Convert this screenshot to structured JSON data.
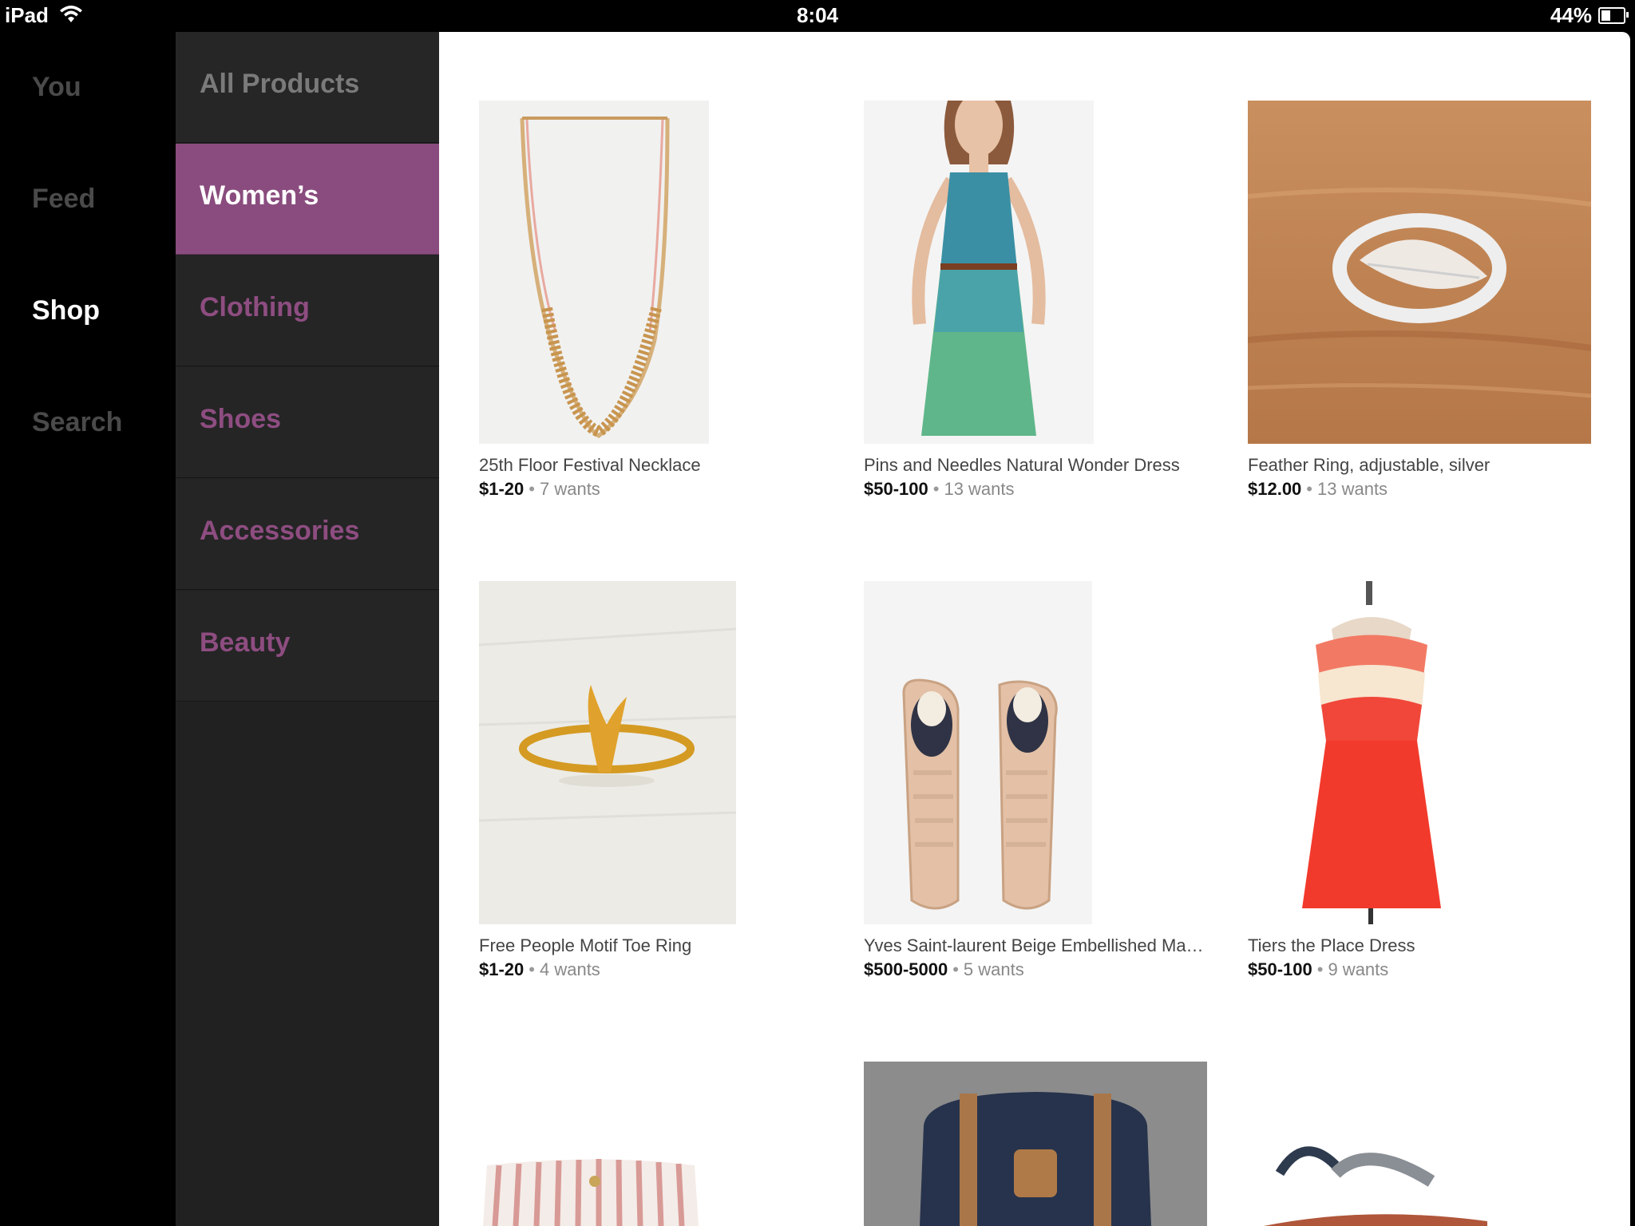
{
  "status_bar": {
    "device": "iPad",
    "time": "8:04",
    "battery": "44%",
    "battery_level": 0.44
  },
  "main_nav": {
    "items": [
      {
        "label": "You",
        "active": false
      },
      {
        "label": "Feed",
        "active": false
      },
      {
        "label": "Shop",
        "active": true
      },
      {
        "label": "Search",
        "active": false
      }
    ]
  },
  "category_nav": {
    "items": [
      {
        "label": "All Products",
        "state": "parent"
      },
      {
        "label": "Women’s",
        "state": "active"
      },
      {
        "label": "Clothing",
        "state": "normal"
      },
      {
        "label": "Shoes",
        "state": "normal"
      },
      {
        "label": "Accessories",
        "state": "normal"
      },
      {
        "label": "Beauty",
        "state": "normal"
      }
    ]
  },
  "products": [
    {
      "title": "25th Floor Festival Necklace",
      "price": "$1-20",
      "wants": "7 wants",
      "image": "necklace"
    },
    {
      "title": "Pins and Needles Natural Wonder Dress",
      "price": "$50-100",
      "wants": "13 wants",
      "image": "teal-dress"
    },
    {
      "title": "Feather Ring, adjustable, silver",
      "price": "$12.00",
      "wants": "13 wants",
      "image": "feather-ring"
    },
    {
      "title": "Free People Motif Toe Ring",
      "price": "$1-20",
      "wants": "4 wants",
      "image": "toe-ring"
    },
    {
      "title": "Yves Saint-laurent Beige Embellished Ma…",
      "price": "$500-5000",
      "wants": "5 wants",
      "image": "sneakers"
    },
    {
      "title": "Tiers the Place Dress",
      "price": "$50-100",
      "wants": "9 wants",
      "image": "red-dress"
    },
    {
      "title": "",
      "price": "",
      "wants": "",
      "image": "striped-shorts"
    },
    {
      "title": "",
      "price": "",
      "wants": "",
      "image": "backpack"
    },
    {
      "title": "",
      "price": "",
      "wants": "",
      "image": "sandal"
    }
  ],
  "colors": {
    "accent": "#8a4c7e",
    "category_text": "#8e4d81",
    "sidebar_bg": "#000000",
    "category_bg": "#252525",
    "content_bg": "#ffffff"
  }
}
